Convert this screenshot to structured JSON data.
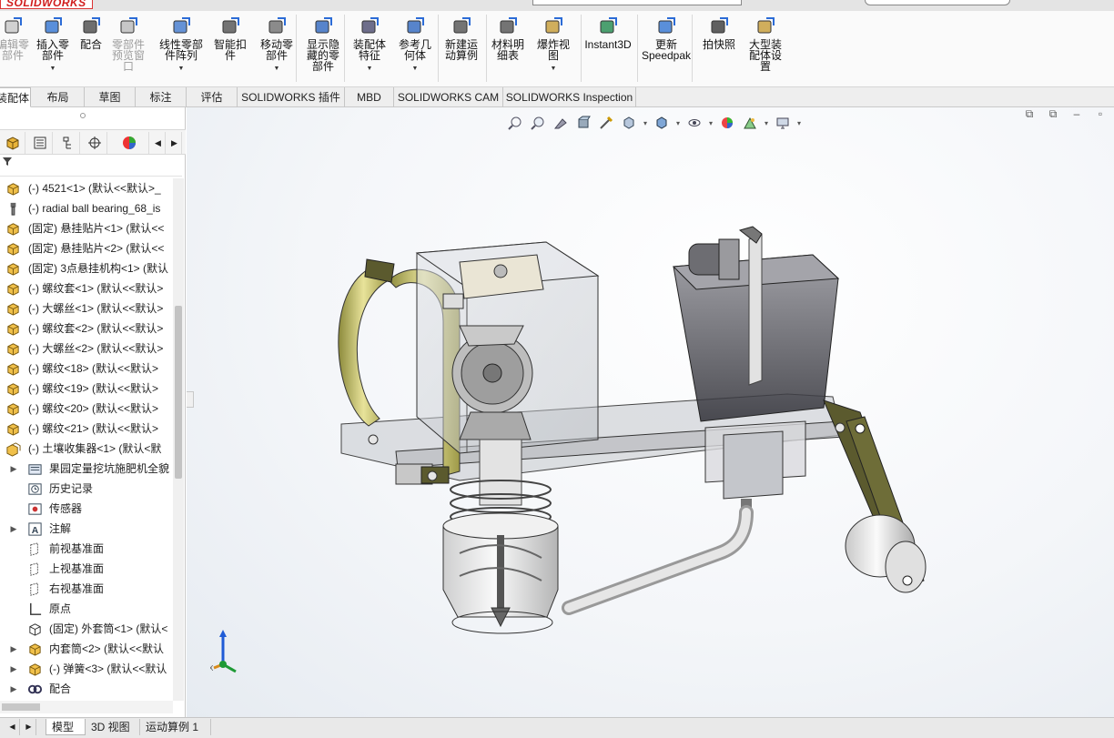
{
  "app": {
    "logo": "SOLIDWORKS"
  },
  "ribbon": {
    "buttons": [
      {
        "label": "编辑零\n部件",
        "icon": "edit-component-icon",
        "disabled": true,
        "dropdown": false
      },
      {
        "label": "插入零\n部件",
        "icon": "insert-component-icon",
        "disabled": false,
        "dropdown": true
      },
      {
        "label": "配合",
        "icon": "mate-icon",
        "disabled": false,
        "dropdown": false
      },
      {
        "label": "零部件\n预览窗\n口",
        "icon": "component-preview-icon",
        "disabled": true,
        "dropdown": false
      },
      {
        "label": "线性零部\n件阵列",
        "icon": "linear-pattern-icon",
        "disabled": false,
        "dropdown": true
      },
      {
        "label": "智能扣\n件",
        "icon": "smart-fastener-icon",
        "disabled": false,
        "dropdown": false
      },
      {
        "label": "移动零\n部件",
        "icon": "move-component-icon",
        "disabled": false,
        "dropdown": true
      },
      {
        "label": "显示隐\n藏的零\n部件",
        "icon": "show-hidden-icon",
        "disabled": false,
        "dropdown": false
      },
      {
        "label": "装配体\n特征",
        "icon": "assembly-feature-icon",
        "disabled": false,
        "dropdown": true
      },
      {
        "label": "参考几\n何体",
        "icon": "reference-geometry-icon",
        "disabled": false,
        "dropdown": true
      },
      {
        "label": "新建运\n动算例",
        "icon": "motion-study-icon",
        "disabled": false,
        "dropdown": false
      },
      {
        "label": "材料明\n细表",
        "icon": "bom-icon",
        "disabled": false,
        "dropdown": false
      },
      {
        "label": "爆炸视\n图",
        "icon": "exploded-view-icon",
        "disabled": false,
        "dropdown": true
      },
      {
        "label": "Instant3D",
        "icon": "instant3d-icon",
        "disabled": false,
        "dropdown": false
      },
      {
        "label": "更新\nSpeedpak",
        "icon": "speedpak-icon",
        "disabled": false,
        "dropdown": false
      },
      {
        "label": "拍快照",
        "icon": "snapshot-icon",
        "disabled": false,
        "dropdown": false
      },
      {
        "label": "大型装\n配体设\n置",
        "icon": "large-assembly-icon",
        "disabled": false,
        "dropdown": false
      }
    ]
  },
  "command_tabs": [
    "装配体",
    "布局",
    "草图",
    "标注",
    "评估",
    "SOLIDWORKS 插件",
    "MBD",
    "SOLIDWORKS CAM",
    "SOLIDWORKS Inspection"
  ],
  "feature_manager": {
    "tree": [
      {
        "text": "(-) 4521<1> (默认<<默认>_",
        "icon": "part-icon",
        "expand": false,
        "indent": 0
      },
      {
        "text": "(-) radial ball bearing_68_is",
        "icon": "toolbox-part-icon",
        "expand": false,
        "indent": 0
      },
      {
        "text": "(固定) 悬挂贴片<1> (默认<<",
        "icon": "part-icon",
        "expand": false,
        "indent": 0
      },
      {
        "text": "(固定) 悬挂贴片<2> (默认<<",
        "icon": "part-icon",
        "expand": false,
        "indent": 0
      },
      {
        "text": "(固定) 3点悬挂机构<1> (默认",
        "icon": "part-icon",
        "expand": false,
        "indent": 0
      },
      {
        "text": "(-) 螺纹套<1> (默认<<默认>",
        "icon": "part-icon",
        "expand": false,
        "indent": 0
      },
      {
        "text": "(-) 大螺丝<1> (默认<<默认>",
        "icon": "part-icon",
        "expand": false,
        "indent": 0
      },
      {
        "text": "(-) 螺纹套<2> (默认<<默认>",
        "icon": "part-icon",
        "expand": false,
        "indent": 0
      },
      {
        "text": "(-) 大螺丝<2> (默认<<默认>",
        "icon": "part-icon",
        "expand": false,
        "indent": 0
      },
      {
        "text": "(-) 螺纹<18> (默认<<默认>",
        "icon": "part-icon",
        "expand": false,
        "indent": 0
      },
      {
        "text": "(-) 螺纹<19> (默认<<默认>",
        "icon": "part-icon",
        "expand": false,
        "indent": 0
      },
      {
        "text": "(-) 螺纹<20> (默认<<默认>",
        "icon": "part-icon",
        "expand": false,
        "indent": 0
      },
      {
        "text": "(-) 螺纹<21> (默认<<默认>",
        "icon": "part-icon",
        "expand": false,
        "indent": 0
      },
      {
        "text": "(-) 土壤收集器<1> (默认<默",
        "icon": "subassembly-icon",
        "expand": false,
        "indent": 0
      },
      {
        "text": "果园定量挖坑施肥机全貌",
        "icon": "history-folder-icon",
        "expand": true,
        "indent": 1
      },
      {
        "text": "历史记录",
        "icon": "history-icon",
        "expand": false,
        "indent": 1
      },
      {
        "text": "传感器",
        "icon": "sensor-icon",
        "expand": false,
        "indent": 1
      },
      {
        "text": "注解",
        "icon": "annotation-icon",
        "expand": true,
        "indent": 1
      },
      {
        "text": "前视基准面",
        "icon": "plane-icon",
        "expand": false,
        "indent": 1
      },
      {
        "text": "上视基准面",
        "icon": "plane-icon",
        "expand": false,
        "indent": 1
      },
      {
        "text": "右视基准面",
        "icon": "plane-icon",
        "expand": false,
        "indent": 1
      },
      {
        "text": "原点",
        "icon": "origin-icon",
        "expand": false,
        "indent": 1
      },
      {
        "text": "(固定) 外套筒<1> (默认<",
        "icon": "part-outline-icon",
        "expand": false,
        "indent": 1
      },
      {
        "text": "内套筒<2> (默认<<默认",
        "icon": "part-icon",
        "expand": true,
        "indent": 1
      },
      {
        "text": "(-) 弹簧<3> (默认<<默认",
        "icon": "part-icon",
        "expand": true,
        "indent": 1
      },
      {
        "text": "配合",
        "icon": "mate-folder-icon",
        "expand": true,
        "indent": 1
      }
    ]
  },
  "bottom_tabs": [
    "模型",
    "3D 视图",
    "运动算例 1"
  ],
  "triad": {
    "x": "X",
    "y": "Y",
    "z": "Z"
  },
  "colors": {
    "accent": "#1565c0",
    "logo_red": "#d01c1c",
    "yellow_part": "#d8d27a",
    "dark_olive": "#5b5a2e"
  }
}
